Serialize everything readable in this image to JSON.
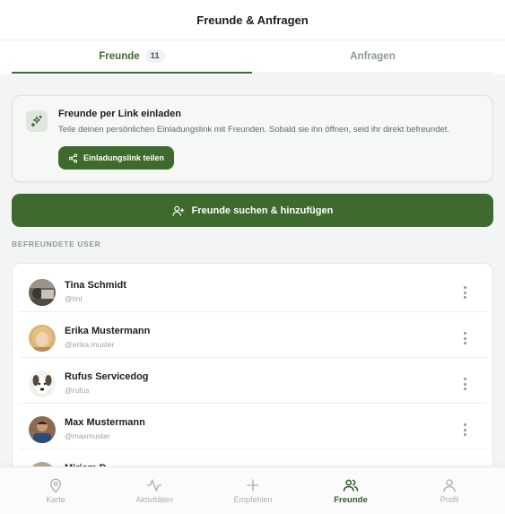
{
  "header": {
    "title": "Freunde & Anfragen"
  },
  "tabs": {
    "friends_label": "Freunde",
    "friends_count": "11",
    "requests_label": "Anfragen"
  },
  "invite": {
    "title": "Freunde per Link einladen",
    "description": "Teile deinen persönlichen Einladungslink mit Freunden. Sobald sie ihn öffnen, seid ihr direkt befreundet.",
    "button_label": "Einladungslink teilen",
    "icon": "sparkles-icon",
    "button_icon": "share-icon"
  },
  "search_button": {
    "label": "Freunde suchen & hinzufügen",
    "icon": "user-plus-icon"
  },
  "section": {
    "heading": "BEFREUNDETE USER"
  },
  "friends": [
    {
      "name": "Tina Schmidt",
      "handle": "@tini"
    },
    {
      "name": "Erika Mustermann",
      "handle": "@erika.muster"
    },
    {
      "name": "Rufus Servicedog",
      "handle": "@rufus"
    },
    {
      "name": "Max Mustermann",
      "handle": "@maxmuster"
    },
    {
      "name": "Miriam D.",
      "handle": ""
    }
  ],
  "bottom_nav": [
    {
      "label": "Karte",
      "icon": "map-pin-icon",
      "active": false
    },
    {
      "label": "Aktivitäten",
      "icon": "activity-icon",
      "active": false
    },
    {
      "label": "Empfehlen",
      "icon": "plus-icon",
      "active": false
    },
    {
      "label": "Freunde",
      "icon": "users-icon",
      "active": true
    },
    {
      "label": "Profil",
      "icon": "user-icon",
      "active": false
    }
  ],
  "colors": {
    "accent": "#3e6a2e",
    "background": "#f3f4f4",
    "muted_text": "#8d9aa0"
  }
}
